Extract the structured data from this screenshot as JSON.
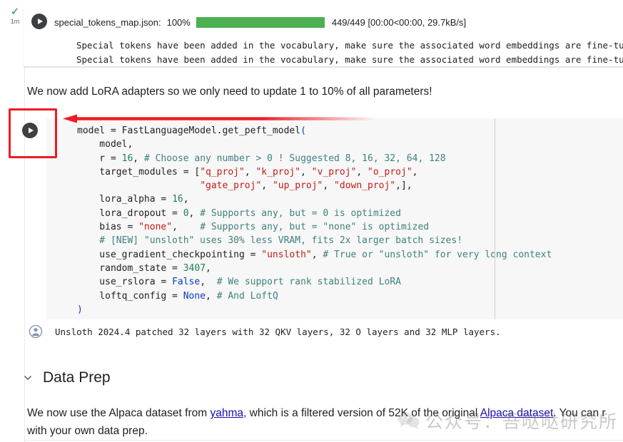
{
  "gutter": {
    "status_icon": "check-icon",
    "run_time": "1m"
  },
  "output_cell": {
    "play_icon": "play-icon",
    "progress": {
      "label": "special_tokens_map.json:",
      "percent": "100%",
      "fill_percent": 100,
      "stats": "449/449 [00:00<00:00, 29.7kB/s]",
      "bar_color": "#4caf50"
    },
    "lines": [
      "Special tokens have been added in the vocabulary, make sure the associated word embeddings are fine-tune",
      "Special tokens have been added in the vocabulary, make sure the associated word embeddings are fine-tune"
    ]
  },
  "markdown_intro": "We now add LoRA adapters so we only need to update 1 to 10% of all parameters!",
  "code_cell": {
    "play_icon": "play-icon",
    "lines": [
      [
        {
          "t": "model = FastLanguageModel.get_peft_model",
          "c": "tok-def"
        },
        {
          "t": "(",
          "c": "tok-paren"
        }
      ],
      [
        {
          "t": "    model,",
          "c": "tok-def"
        }
      ],
      [
        {
          "t": "    r = ",
          "c": "tok-def"
        },
        {
          "t": "16",
          "c": "tok-num"
        },
        {
          "t": ", ",
          "c": "tok-def"
        },
        {
          "t": "# Choose any number > 0 ! Suggested 8, 16, 32, 64, 128",
          "c": "tok-com"
        }
      ],
      [
        {
          "t": "    target_modules = [",
          "c": "tok-def"
        },
        {
          "t": "\"q_proj\"",
          "c": "tok-str"
        },
        {
          "t": ", ",
          "c": "tok-def"
        },
        {
          "t": "\"k_proj\"",
          "c": "tok-str"
        },
        {
          "t": ", ",
          "c": "tok-def"
        },
        {
          "t": "\"v_proj\"",
          "c": "tok-str"
        },
        {
          "t": ", ",
          "c": "tok-def"
        },
        {
          "t": "\"o_proj\"",
          "c": "tok-str"
        },
        {
          "t": ",",
          "c": "tok-def"
        }
      ],
      [
        {
          "t": "                      ",
          "c": "tok-def"
        },
        {
          "t": "\"gate_proj\"",
          "c": "tok-str"
        },
        {
          "t": ", ",
          "c": "tok-def"
        },
        {
          "t": "\"up_proj\"",
          "c": "tok-str"
        },
        {
          "t": ", ",
          "c": "tok-def"
        },
        {
          "t": "\"down_proj\"",
          "c": "tok-str"
        },
        {
          "t": ",],",
          "c": "tok-def"
        }
      ],
      [
        {
          "t": "    lora_alpha = ",
          "c": "tok-def"
        },
        {
          "t": "16",
          "c": "tok-num"
        },
        {
          "t": ",",
          "c": "tok-def"
        }
      ],
      [
        {
          "t": "    lora_dropout = ",
          "c": "tok-def"
        },
        {
          "t": "0",
          "c": "tok-num"
        },
        {
          "t": ", ",
          "c": "tok-def"
        },
        {
          "t": "# Supports any, but = 0 is optimized",
          "c": "tok-com"
        }
      ],
      [
        {
          "t": "    bias = ",
          "c": "tok-def"
        },
        {
          "t": "\"none\"",
          "c": "tok-str"
        },
        {
          "t": ",    ",
          "c": "tok-def"
        },
        {
          "t": "# Supports any, but = \"none\" is optimized",
          "c": "tok-com"
        }
      ],
      [
        {
          "t": "    # [NEW] \"unsloth\" uses 30% less VRAM, fits 2x larger batch sizes!",
          "c": "tok-com"
        }
      ],
      [
        {
          "t": "    use_gradient_checkpointing = ",
          "c": "tok-def"
        },
        {
          "t": "\"unsloth\"",
          "c": "tok-str"
        },
        {
          "t": ", ",
          "c": "tok-def"
        },
        {
          "t": "# True or \"unsloth\" for very long context",
          "c": "tok-com"
        }
      ],
      [
        {
          "t": "    random_state = ",
          "c": "tok-def"
        },
        {
          "t": "3407",
          "c": "tok-num"
        },
        {
          "t": ",",
          "c": "tok-def"
        }
      ],
      [
        {
          "t": "    use_rslora = ",
          "c": "tok-def"
        },
        {
          "t": "False",
          "c": "tok-blue"
        },
        {
          "t": ",  ",
          "c": "tok-def"
        },
        {
          "t": "# We support rank stabilized LoRA",
          "c": "tok-com"
        }
      ],
      [
        {
          "t": "    loftq_config = ",
          "c": "tok-def"
        },
        {
          "t": "None",
          "c": "tok-blue"
        },
        {
          "t": ", ",
          "c": "tok-def"
        },
        {
          "t": "# And LoftQ",
          "c": "tok-com"
        }
      ],
      [
        {
          "t": ")",
          "c": "tok-paren"
        }
      ]
    ]
  },
  "annotations": {
    "highlight_box": "red-highlight-box",
    "arrow": "red-arrow-pointing-left",
    "color": "#ed1c24"
  },
  "stdout": {
    "avatar_icon": "user-avatar-icon",
    "text": "Unsloth 2024.4 patched 32 layers with 32 QKV layers, 32 O layers and 32 MLP layers."
  },
  "section": {
    "chevron_icon": "chevron-down-icon",
    "title": "Data Prep"
  },
  "bottom_paragraph": {
    "part1": "We now use the Alpaca dataset from ",
    "link1": "yahma",
    "part2": ", which is a filtered version of 52K of the original ",
    "link2": "Alpaca dataset",
    "part3": ". You can r",
    "line2": "with your own data prep."
  },
  "watermark": {
    "icon": "wechat-bubble-icon",
    "text": "公众号：吾哒哒研究所"
  }
}
